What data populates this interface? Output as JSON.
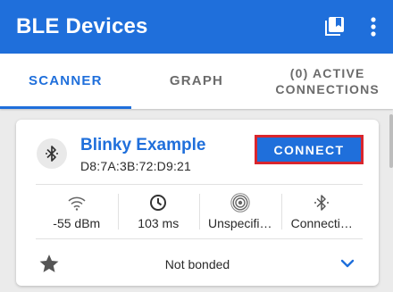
{
  "appbar": {
    "title": "BLE Devices",
    "icons": [
      "bookmarks-icon",
      "more-vert-icon"
    ]
  },
  "tabs": [
    {
      "label": "SCANNER",
      "active": true
    },
    {
      "label": "GRAPH",
      "active": false
    },
    {
      "label_line1": "(0) ACTIVE",
      "label_line2": "CONNECTIONS",
      "active": false
    }
  ],
  "device": {
    "name": "Blinky Example",
    "address": "D8:7A:3B:72:D9:21",
    "connect_label": "CONNECT",
    "stats": {
      "rssi": "-55 dBm",
      "interval": "103 ms",
      "tx_power": "Unspecifi…",
      "connectable": "Connecti…"
    },
    "bond_status": "Not bonded"
  },
  "colors": {
    "primary": "#1f6fdb",
    "highlight_border": "#d9262d",
    "background": "#ebebeb"
  }
}
